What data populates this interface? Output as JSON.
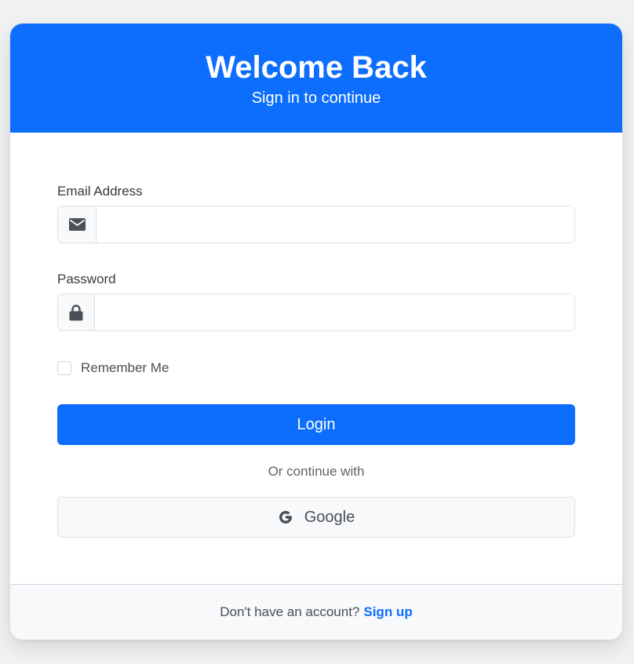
{
  "header": {
    "title": "Welcome Back",
    "subtitle": "Sign in to continue"
  },
  "form": {
    "email": {
      "label": "Email Address",
      "icon": "envelope-icon",
      "value": "",
      "placeholder": ""
    },
    "password": {
      "label": "Password",
      "icon": "lock-icon",
      "value": "",
      "placeholder": ""
    },
    "remember_label": "Remember Me",
    "login_label": "Login",
    "divider_text": "Or continue with",
    "google_label": "Google"
  },
  "footer": {
    "prompt": "Don't have an account?",
    "signup_label": "Sign up"
  },
  "colors": {
    "primary": "#0d6efd",
    "footer_bg": "#f8f9fa"
  }
}
